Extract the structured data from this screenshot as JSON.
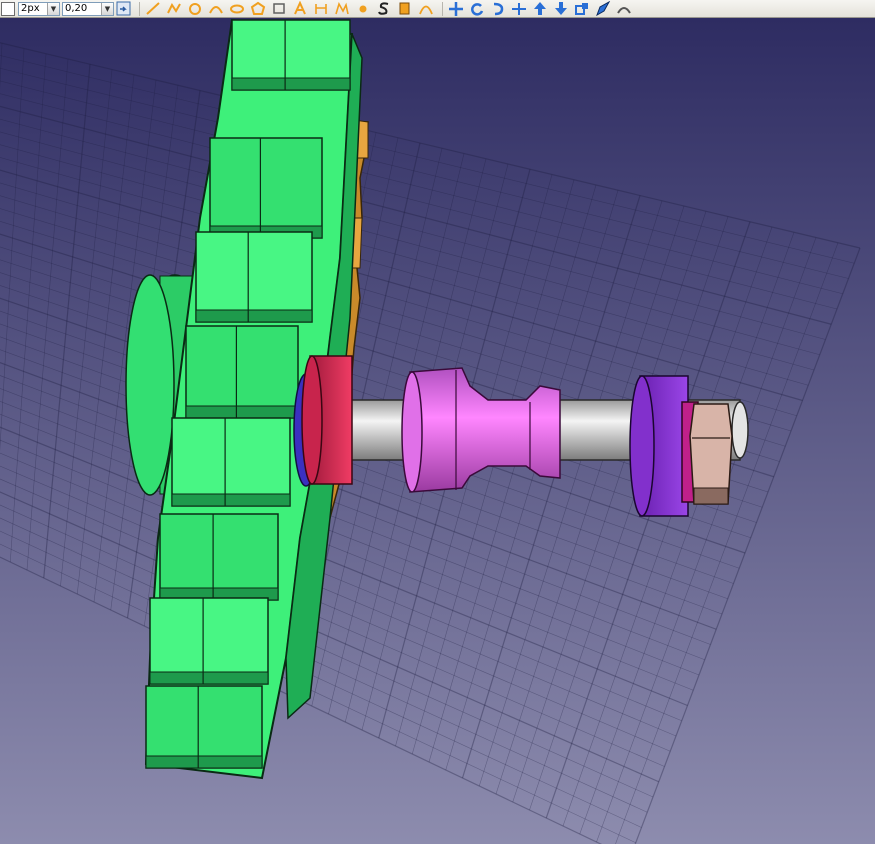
{
  "toolbar": {
    "first_box_state": "unchecked",
    "line_width": {
      "value": "2px"
    },
    "offset": {
      "value": "0,20"
    },
    "draw_icons": [
      {
        "name": "pen-line-icon",
        "color": "#f0a020"
      },
      {
        "name": "polyline-icon",
        "color": "#f0a020"
      },
      {
        "name": "circle-icon",
        "color": "#f0a020"
      },
      {
        "name": "arc-icon",
        "color": "#f0a020"
      },
      {
        "name": "ellipse-icon",
        "color": "#f0a020"
      },
      {
        "name": "polygon-icon",
        "color": "#f0a020"
      },
      {
        "name": "rectangle-icon",
        "color": "#606060"
      },
      {
        "name": "text-icon",
        "color": "#f0a020"
      },
      {
        "name": "dimension-icon",
        "color": "#f0a020"
      },
      {
        "name": "bspline-icon",
        "color": "#f0a020"
      },
      {
        "name": "point-icon",
        "color": "#f0a020"
      },
      {
        "name": "shape-string-icon",
        "color": "#f0a020"
      },
      {
        "name": "facebinder-icon",
        "color": "#f0a020"
      },
      {
        "name": "bezier-icon",
        "color": "#f0a020"
      }
    ],
    "modify_icons": [
      {
        "name": "move-icon",
        "color": "#2a6fd6"
      },
      {
        "name": "rotate-icon",
        "color": "#2a6fd6"
      },
      {
        "name": "offset-icon",
        "color": "#2a6fd6"
      },
      {
        "name": "trim-icon",
        "color": "#2a6fd6"
      },
      {
        "name": "upgrade-icon",
        "color": "#2a6fd6"
      },
      {
        "name": "downgrade-icon",
        "color": "#2a6fd6"
      },
      {
        "name": "scale-icon",
        "color": "#2a6fd6"
      },
      {
        "name": "edit-icon",
        "color": "#2a6fd6"
      },
      {
        "name": "wire-to-bspline-icon",
        "color": "#2a6fd6"
      }
    ]
  },
  "viewport": {
    "background_top": "#2e2c62",
    "background_bottom": "#8d8cae",
    "grid_color": "#1e1d40",
    "parts": [
      {
        "name": "gear",
        "color": "#3ef07a"
      },
      {
        "name": "gear-hub",
        "color": "#2fd46a"
      },
      {
        "name": "rear-gear",
        "color": "#c98a2a"
      },
      {
        "name": "red-collar",
        "color": "#e8305a"
      },
      {
        "name": "shaft",
        "color": "#d4d4d4"
      },
      {
        "name": "pink-spacer",
        "color": "#f070f0"
      },
      {
        "name": "purple-washer",
        "color": "#8a36d8"
      },
      {
        "name": "magenta-washer",
        "color": "#c0208a"
      },
      {
        "name": "hex-nut",
        "color": "#d8b4a8"
      }
    ]
  }
}
